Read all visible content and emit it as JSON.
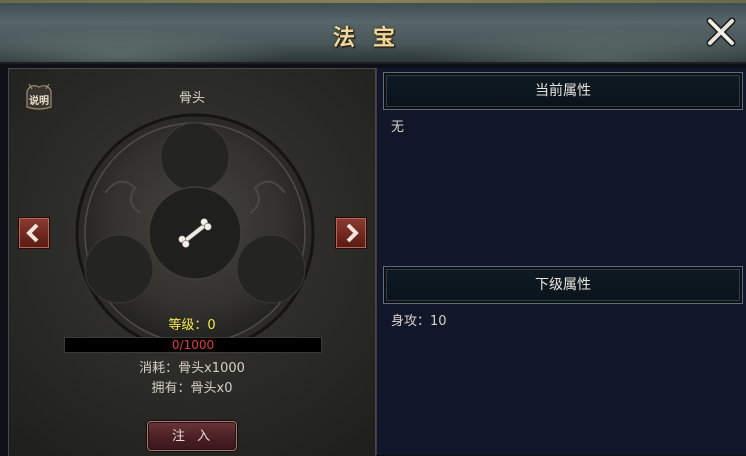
{
  "window": {
    "title": "法宝"
  },
  "left": {
    "help_label": "说明",
    "item_name": "骨头",
    "level_text": "等级：0",
    "progress": {
      "current": 0,
      "max": 1000,
      "text": "0/1000"
    },
    "cost_text": "消耗：骨头x1000",
    "own_text": "拥有：骨头x0",
    "inject_label": "注入"
  },
  "right": {
    "current_header": "当前属性",
    "current_value": "无",
    "next_header": "下级属性",
    "next_value": "身攻：10"
  },
  "colors": {
    "title": "#f2d79a",
    "level": "#f4e94a",
    "progress_text": "#e23a3a",
    "right_bg": "#12162a"
  },
  "icons": [
    "close-icon",
    "help-icon",
    "bone-icon",
    "chevron-left-icon",
    "chevron-right-icon"
  ]
}
